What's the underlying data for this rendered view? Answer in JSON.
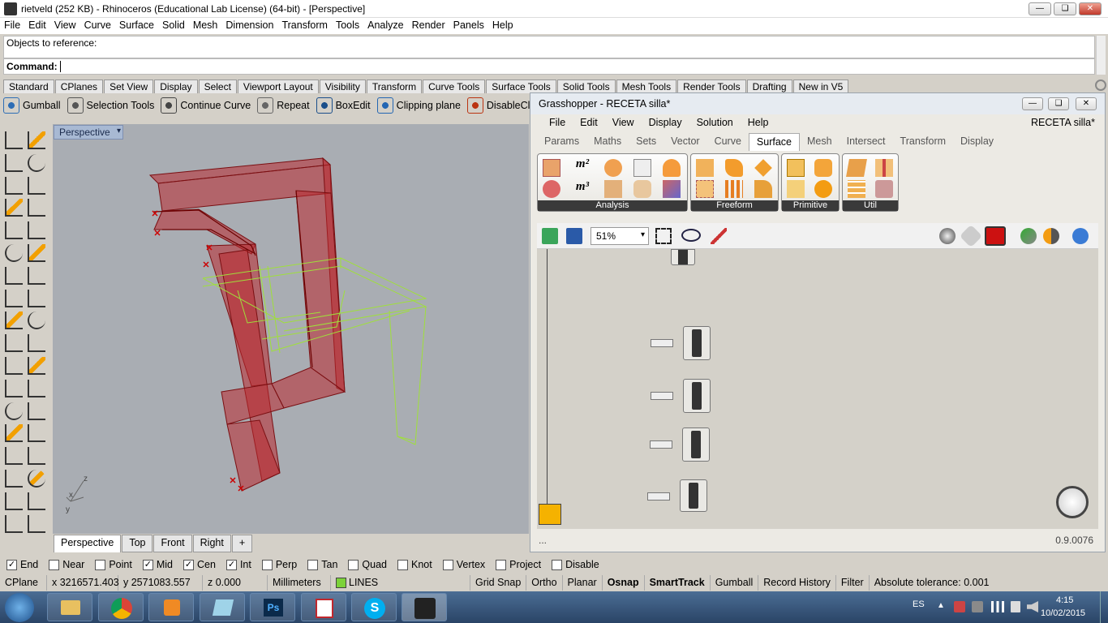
{
  "window": {
    "title": "rietveld (252 KB) - Rhinoceros (Educational Lab License) (64-bit) - [Perspective]"
  },
  "menu": [
    "File",
    "Edit",
    "View",
    "Curve",
    "Surface",
    "Solid",
    "Mesh",
    "Dimension",
    "Transform",
    "Tools",
    "Analyze",
    "Render",
    "Panels",
    "Help"
  ],
  "command": {
    "history": "Objects to reference:",
    "prompt": "Command:"
  },
  "toolbar_tabs": [
    "Standard",
    "CPlanes",
    "Set View",
    "Display",
    "Select",
    "Viewport Layout",
    "Visibility",
    "Transform",
    "Curve Tools",
    "Surface Tools",
    "Solid Tools",
    "Mesh Tools",
    "Render Tools",
    "Drafting",
    "New in V5"
  ],
  "toolbar_items": [
    {
      "label": "Gumball",
      "icon": "gumball-icon"
    },
    {
      "label": "Selection Tools",
      "icon": "selection-icon"
    },
    {
      "label": "Continue Curve",
      "icon": "curve-icon"
    },
    {
      "label": "Repeat",
      "icon": "repeat-icon"
    },
    {
      "label": "BoxEdit",
      "icon": "boxedit-icon"
    },
    {
      "label": "Clipping plane",
      "icon": "clipping-plane-icon"
    },
    {
      "label": "DisableClippingPlane",
      "icon": "disable-clipping-icon"
    }
  ],
  "viewport": {
    "title": "Perspective",
    "axes": {
      "x": "x",
      "y": "y",
      "z": "z"
    }
  },
  "viewport_tabs": [
    "Perspective",
    "Top",
    "Front",
    "Right",
    "+"
  ],
  "osnaps": [
    {
      "label": "End",
      "checked": true
    },
    {
      "label": "Near",
      "checked": false
    },
    {
      "label": "Point",
      "checked": false
    },
    {
      "label": "Mid",
      "checked": true
    },
    {
      "label": "Cen",
      "checked": true
    },
    {
      "label": "Int",
      "checked": true
    },
    {
      "label": "Perp",
      "checked": false
    },
    {
      "label": "Tan",
      "checked": false
    },
    {
      "label": "Quad",
      "checked": false
    },
    {
      "label": "Knot",
      "checked": false
    },
    {
      "label": "Vertex",
      "checked": false
    },
    {
      "label": "Project",
      "checked": false
    },
    {
      "label": "Disable",
      "checked": false
    }
  ],
  "status": {
    "cplane": "CPlane",
    "x": "x 3216571.403",
    "y": "y 2571083.557",
    "z": "z 0.000",
    "units": "Millimeters",
    "layer": "LINES",
    "layer_color": "#7cd23a",
    "toggles": [
      "Grid Snap",
      "Ortho",
      "Planar",
      "Osnap",
      "SmartTrack",
      "Gumball",
      "Record History",
      "Filter"
    ],
    "tolerance": "Absolute tolerance: 0.001"
  },
  "grasshopper": {
    "title": "Grasshopper - RECETA silla*",
    "menu": [
      "File",
      "Edit",
      "View",
      "Display",
      "Solution",
      "Help"
    ],
    "doc_name": "RECETA silla*",
    "tabs": [
      "Params",
      "Maths",
      "Sets",
      "Vector",
      "Curve",
      "Surface",
      "Mesh",
      "Intersect",
      "Transform",
      "Display"
    ],
    "active_tab": "Surface",
    "groups": [
      "Analysis",
      "Freeform",
      "Primitive",
      "Util"
    ],
    "zoom": "51%",
    "version": "0.9.0076",
    "status_left": "..."
  },
  "taskbar": {
    "lang": "ES",
    "time": "4:15",
    "date": "10/02/2015"
  }
}
